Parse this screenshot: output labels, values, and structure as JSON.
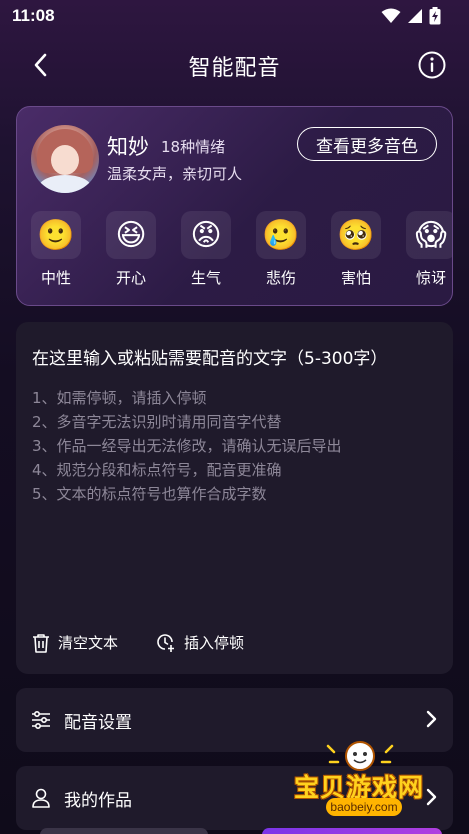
{
  "status_bar": {
    "time": "11:08",
    "icons": [
      "wifi-icon",
      "signal-icon",
      "battery-charging-icon"
    ]
  },
  "header": {
    "title": "智能配音",
    "back_icon": "chevron-left-icon",
    "info_icon": "info-icon"
  },
  "voice": {
    "name": "知妙",
    "emotion_count": "18种情绪",
    "description": "温柔女声，亲切可人",
    "more_button": "查看更多音色",
    "emotions": [
      {
        "label": "中性",
        "emoji": "🙂"
      },
      {
        "label": "开心",
        "emoji": "😆"
      },
      {
        "label": "生气",
        "emoji": "😡"
      },
      {
        "label": "悲伤",
        "emoji": "🥲"
      },
      {
        "label": "害怕",
        "emoji": "🥺"
      },
      {
        "label": "惊讶",
        "emoji": "😱"
      }
    ]
  },
  "text_input": {
    "placeholder": "在这里输入或粘贴需要配音的文字（5-300字）",
    "tips": [
      "1、如需停顿，请插入停顿",
      "2、多音字无法识别时请用同音字代替",
      "3、作品一经导出无法修改，请确认无误后导出",
      "4、规范分段和标点符号，配音更准确",
      "5、文本的标点符号也算作合成字数"
    ],
    "clear_label": "清空文本",
    "pause_label": "插入停顿"
  },
  "rows": {
    "settings_label": "配音设置",
    "works_label": "我的作品"
  },
  "watermark": {
    "text": "宝贝游戏网",
    "url": "baobeiy.com"
  }
}
